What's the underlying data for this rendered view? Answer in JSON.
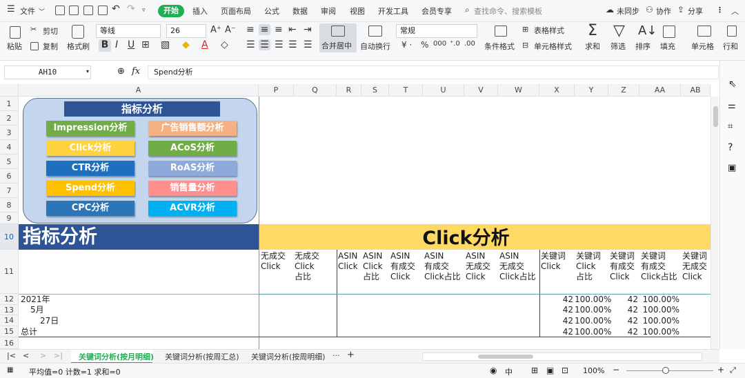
{
  "menu": {
    "file": "文件",
    "start": "开始",
    "items": [
      "插入",
      "页面布局",
      "公式",
      "数据",
      "审阅",
      "视图",
      "开发工具",
      "会员专享"
    ],
    "search_placeholder": "查找命令、搜索模板",
    "sync": "未同步",
    "collab": "协作",
    "share": "分享"
  },
  "ribbon": {
    "paste": "粘贴",
    "cut": "剪切",
    "copy": "复制",
    "format_painter": "格式刷",
    "font_name": "等线",
    "font_size": "26",
    "merge_center": "合并居中",
    "wrap_text": "自动换行",
    "number_format": "常规",
    "cond_format": "条件格式",
    "table_style": "表格样式",
    "cell_style": "单元格样式",
    "sum": "求和",
    "filter": "筛选",
    "sort": "排序",
    "fill": "填充",
    "cell": "单元格",
    "row_col": "行和"
  },
  "formula_bar": {
    "cell_ref": "AH10",
    "fx": "fx",
    "content": "Spend分析"
  },
  "columns": [
    "A",
    "P",
    "Q",
    "R",
    "S",
    "T",
    "U",
    "V",
    "W",
    "X",
    "Y",
    "Z",
    "AA",
    "AB"
  ],
  "rows": [
    "1",
    "2",
    "3",
    "4",
    "5",
    "6",
    "7",
    "8",
    "9",
    "10",
    "11",
    "12",
    "13",
    "14",
    "15",
    "16"
  ],
  "dashboard": {
    "title": "指标分析",
    "buttons": [
      {
        "label": "Impression分析",
        "color": "#70ad47"
      },
      {
        "label": "广告销售额分析",
        "color": "#f4b183"
      },
      {
        "label": "Click分析",
        "color": "#ffd23f"
      },
      {
        "label": "ACoS分析",
        "color": "#70ad47"
      },
      {
        "label": "CTR分析",
        "color": "#1f6fbf"
      },
      {
        "label": "RoAS分析",
        "color": "#8eaadb"
      },
      {
        "label": "Spend分析",
        "color": "#ffc000"
      },
      {
        "label": "销售量分析",
        "color": "#ff8f8f"
      },
      {
        "label": "CPC分析",
        "color": "#2e75b6"
      },
      {
        "label": "ACVR分析",
        "color": "#00b0f0"
      }
    ]
  },
  "sheet": {
    "row10_left": "指标分析",
    "row10_right": "Click分析",
    "headers": [
      "无成交\nClick",
      "无成交\nClick\n占比",
      "ASIN\nClick",
      "ASIN\nClick\n占比",
      "ASIN\n有成交\nClick",
      "ASIN\n有成交\nClick占比",
      "ASIN\n无成交\nClick",
      "ASIN\n无成交\nClick占比",
      "关键词\nClick",
      "关键词\nClick\n占比",
      "关键词\n有成交\nClick",
      "关键词\n有成交\nClick占比",
      "关键词\n无成交\nClick"
    ],
    "labels": [
      "2021年",
      "5月",
      "27日",
      "总计"
    ],
    "data_rows": [
      [
        "42",
        "100.00%",
        "42",
        "100.00%"
      ],
      [
        "42",
        "100.00%",
        "42",
        "100.00%"
      ],
      [
        "42",
        "100.00%",
        "42",
        "100.00%"
      ],
      [
        "42",
        "100.00%",
        "42",
        "100.00%"
      ]
    ]
  },
  "tabs": [
    "关键词分析(按月明细)",
    "关键词分析(按周汇总)",
    "关键词分析(按周明细)"
  ],
  "status": {
    "summary": "平均值=0  计数=1  求和=0",
    "zoom": "100%",
    "lang": "中"
  },
  "colors": {
    "brand_green": "#1fae52",
    "dark_blue": "#2f5496",
    "gold": "#ffd966",
    "teal_line": "#59a8b0"
  }
}
